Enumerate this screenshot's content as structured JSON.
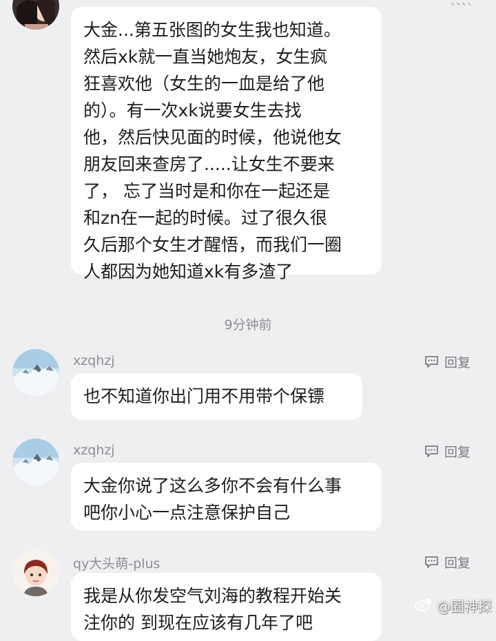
{
  "top_fragment": "、、、、",
  "messages": [
    {
      "lines": [
        "大金...第五张图的女生我也知道。",
        "然后xk就一直当她炮友，女生疯",
        "狂喜欢他（女生的一血是给了他",
        "的）。有一次xk说要女生去找",
        "他，然后快见面的时候，他说他女",
        "朋友回来查房了.....让女生不要来",
        "了， 忘了当时是和你在一起还是",
        "和zn在一起的时候。过了很久很",
        "久后那个女生才醒悟，而我们一圈",
        "人都因为她知道xk有多渣了"
      ]
    }
  ],
  "timestamp": "9分钟前",
  "comments": [
    {
      "username": "xzqhzj",
      "reply_label": "回复",
      "lines": [
        "也不知道你出门用不用带个保镖"
      ]
    },
    {
      "username": "xzqhzj",
      "reply_label": "回复",
      "lines": [
        "大金你说了这么多你不会有什么事",
        "吧你小心一点注意保护自己"
      ]
    },
    {
      "username": "qy大头萌-plus",
      "reply_label": "回复",
      "lines": [
        "我是从你发空气刘海的教程开始关",
        "注你的 到现在应该有几年了吧"
      ]
    }
  ],
  "watermark": "@圈神探",
  "colors": {
    "background": "#efeff1",
    "bubble": "#ffffff",
    "muted_text": "#8e8e93",
    "body_text": "#1d1d1d"
  }
}
